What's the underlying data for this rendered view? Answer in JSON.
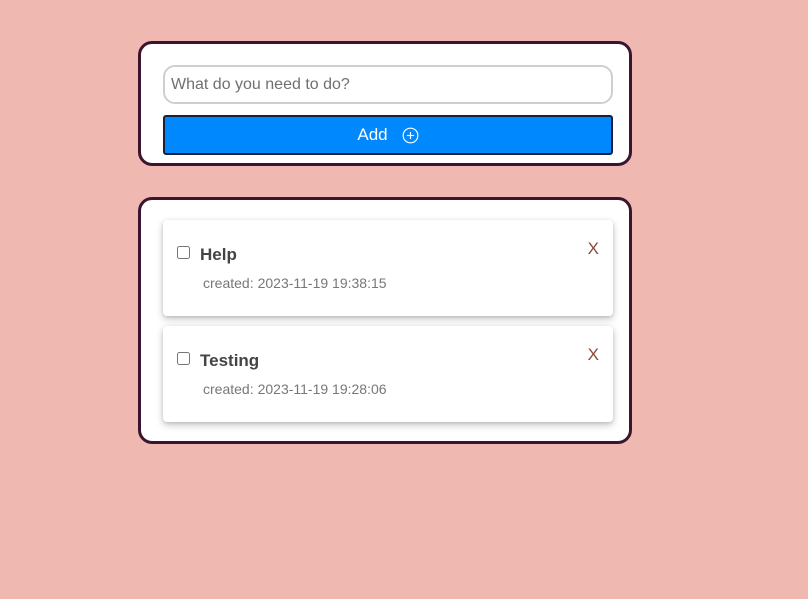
{
  "add_form": {
    "input_placeholder": "What do you need to do?",
    "input_value": "",
    "add_button_label": "Add",
    "add_button_icon": "plus-circle-icon"
  },
  "todos": [
    {
      "title": "Help",
      "created_prefix": "created:",
      "created_at": "2023-11-19 19:38:15",
      "completed": false,
      "delete_label": "X"
    },
    {
      "title": "Testing",
      "created_prefix": "created:",
      "created_at": "2023-11-19 19:28:06",
      "completed": false,
      "delete_label": "X"
    }
  ],
  "colors": {
    "background": "#efb9b1",
    "panel_border": "#3a1530",
    "accent": "#0088ff"
  }
}
